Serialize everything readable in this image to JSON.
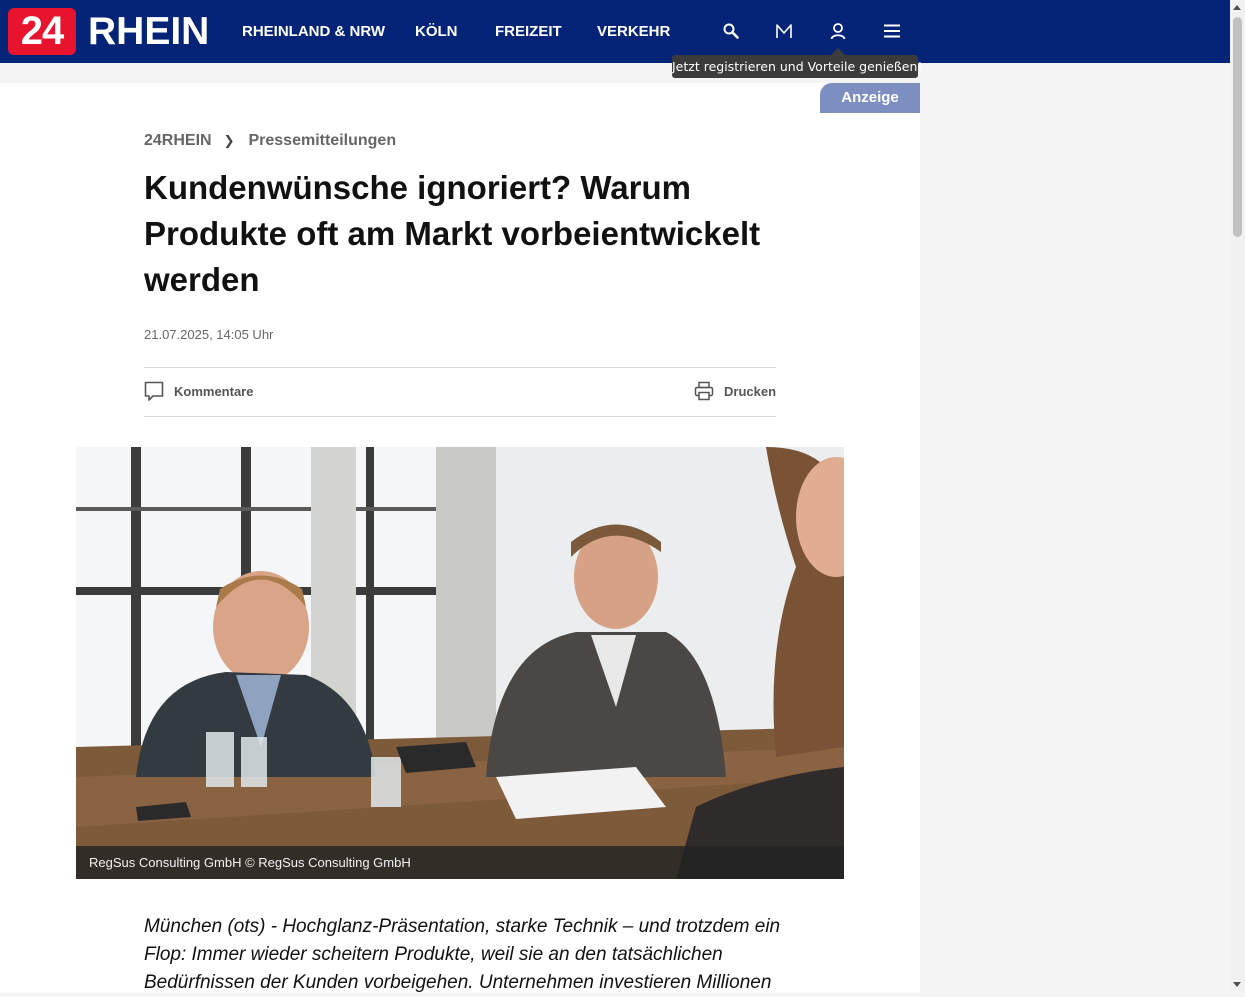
{
  "header": {
    "logo_number": "24",
    "logo_word": "RHEIN",
    "nav": [
      "RHEINLAND & NRW",
      "KÖLN",
      "FREIZEIT",
      "VERKEHR"
    ],
    "icons": [
      "search-icon",
      "mail-icon",
      "user-icon",
      "menu-icon"
    ],
    "tooltip": "Jetzt registrieren und Vorteile genießen!",
    "brand_color": "#052478",
    "logo_color": "#e8132c"
  },
  "ad_label": "Anzeige",
  "article": {
    "breadcrumb": [
      "24RHEIN",
      "Pressemitteilungen"
    ],
    "breadcrumb_separator": "❯",
    "headline": "Kundenwünsche ignoriert? Warum Produkte oft am Markt vorbeientwickelt werden",
    "date": "21.07.2025, 14:05 Uhr",
    "actions": {
      "comments": "Kommentare",
      "print": "Drucken"
    },
    "image_caption": "RegSus Consulting GmbH © RegSus Consulting GmbH",
    "lead": "München (ots) - Hochglanz-Präsentation, starke Technik – und trotzdem ein Flop: Immer wieder scheitern Produkte, weil sie an den tatsächlichen Bedürfnissen der Kunden vorbeigehen. Unternehmen investieren Millionen"
  }
}
